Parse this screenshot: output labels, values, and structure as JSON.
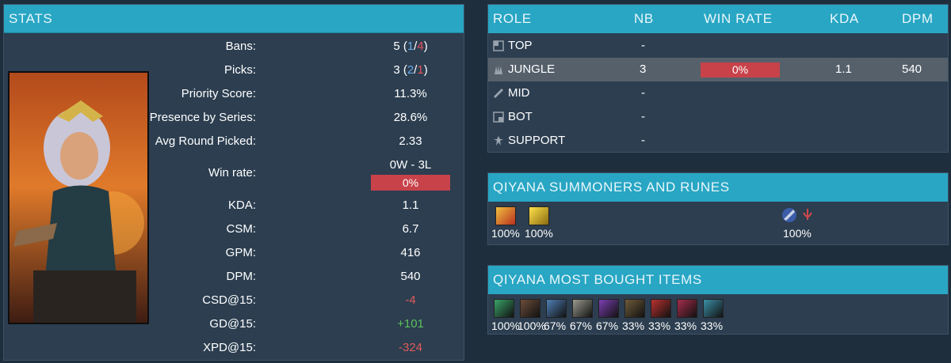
{
  "stats": {
    "header": "STATS",
    "rows": [
      {
        "label": "Bans:",
        "value": "5",
        "blue": "1",
        "red": "4"
      },
      {
        "label": "Picks:",
        "value": "3",
        "blue": "2",
        "red": "1"
      },
      {
        "label": "Priority Score:",
        "value": "11.3%"
      },
      {
        "label": "Presence by Series:",
        "value": "28.6%"
      },
      {
        "label": "Avg Round Picked:",
        "value": "2.33"
      },
      {
        "label": "Win rate:",
        "value": "0W - 3L",
        "bar": "0%"
      },
      {
        "label": "KDA:",
        "value": "1.1"
      },
      {
        "label": "CSM:",
        "value": "6.7"
      },
      {
        "label": "GPM:",
        "value": "416"
      },
      {
        "label": "DPM:",
        "value": "540"
      },
      {
        "label": "CSD@15:",
        "value": "-4"
      },
      {
        "label": "GD@15:",
        "value": "+101"
      },
      {
        "label": "XPD@15:",
        "value": "-324"
      }
    ]
  },
  "roles": {
    "headers": {
      "role": "ROLE",
      "nb": "NB",
      "winrate": "WIN RATE",
      "kda": "KDA",
      "dpm": "DPM"
    },
    "rows": [
      {
        "icon": "top-lane-icon",
        "role": "TOP",
        "nb": "-",
        "winrate": "",
        "kda": "",
        "dpm": ""
      },
      {
        "icon": "jungle-icon",
        "role": "JUNGLE",
        "nb": "3",
        "winrate": "0%",
        "kda": "1.1",
        "dpm": "540"
      },
      {
        "icon": "mid-lane-icon",
        "role": "MID",
        "nb": "-",
        "winrate": "",
        "kda": "",
        "dpm": ""
      },
      {
        "icon": "bot-lane-icon",
        "role": "BOT",
        "nb": "-",
        "winrate": "",
        "kda": "",
        "dpm": ""
      },
      {
        "icon": "support-icon",
        "role": "SUPPORT",
        "nb": "-",
        "winrate": "",
        "kda": "",
        "dpm": ""
      }
    ]
  },
  "summoners": {
    "header": "QIYANA SUMMONERS AND RUNES",
    "spells": [
      {
        "icon": "smite-spell-icon",
        "pct": "100%"
      },
      {
        "icon": "flash-spell-icon",
        "pct": "100%"
      }
    ],
    "runes": {
      "icon": "rune-tree-icon",
      "pct": "100%"
    }
  },
  "items": {
    "header": "QIYANA MOST BOUGHT ITEMS",
    "list": [
      {
        "icon": "item-1-icon",
        "pct": "100%",
        "color": "#3aa36a"
      },
      {
        "icon": "item-2-icon",
        "pct": "100%",
        "color": "#6b4d3a"
      },
      {
        "icon": "item-3-icon",
        "pct": "67%",
        "color": "#4f7fb5"
      },
      {
        "icon": "item-4-icon",
        "pct": "67%",
        "color": "#9a9a8e"
      },
      {
        "icon": "item-5-icon",
        "pct": "67%",
        "color": "#7b3fb0"
      },
      {
        "icon": "item-6-icon",
        "pct": "33%",
        "color": "#6e5b3a"
      },
      {
        "icon": "item-7-icon",
        "pct": "33%",
        "color": "#b8312f"
      },
      {
        "icon": "item-8-icon",
        "pct": "33%",
        "color": "#a32c4b"
      },
      {
        "icon": "item-9-icon",
        "pct": "33%",
        "color": "#3c8fa6"
      }
    ]
  }
}
